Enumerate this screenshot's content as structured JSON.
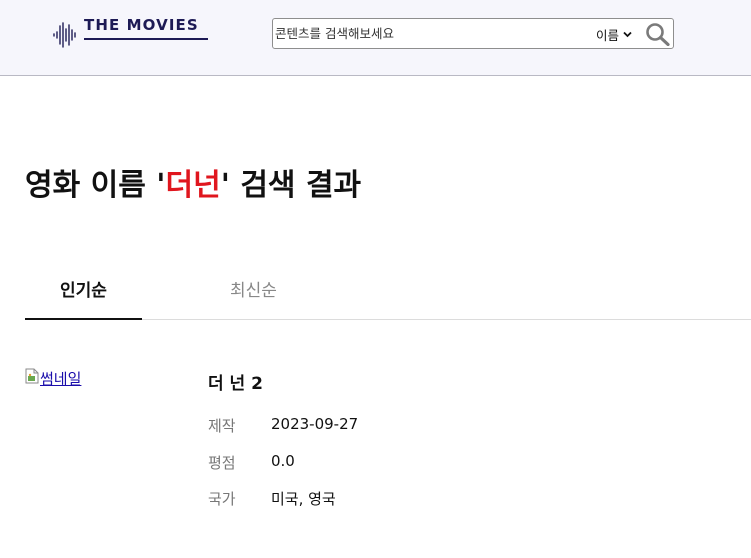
{
  "header": {
    "logo_text": "THE MOVIES",
    "search": {
      "placeholder": "콘텐츠를 검색해보세요",
      "value": "",
      "type_selected": "이름"
    }
  },
  "page": {
    "title_prefix": "영화 이름 '",
    "title_keyword": "더넌",
    "title_suffix": "' 검색 결과"
  },
  "tabs": [
    {
      "label": "인기순",
      "active": true
    },
    {
      "label": "최신순",
      "active": false
    }
  ],
  "results": [
    {
      "thumbnail_alt": "썸네일",
      "title": "더 넌 2",
      "fields": [
        {
          "label": "제작",
          "value": "2023-09-27"
        },
        {
          "label": "평점",
          "value": "0.0"
        },
        {
          "label": "국가",
          "value": "미국, 영국"
        }
      ]
    }
  ],
  "colors": {
    "header_bg": "#f6f6fc",
    "logo": "#1d1a55",
    "highlight": "#e0161e",
    "link": "#1a0dab"
  },
  "icons": {
    "logo": "soundwave-icon",
    "search": "search-icon",
    "dropdown": "chevron-down-icon",
    "thumbnail": "broken-image-icon"
  }
}
